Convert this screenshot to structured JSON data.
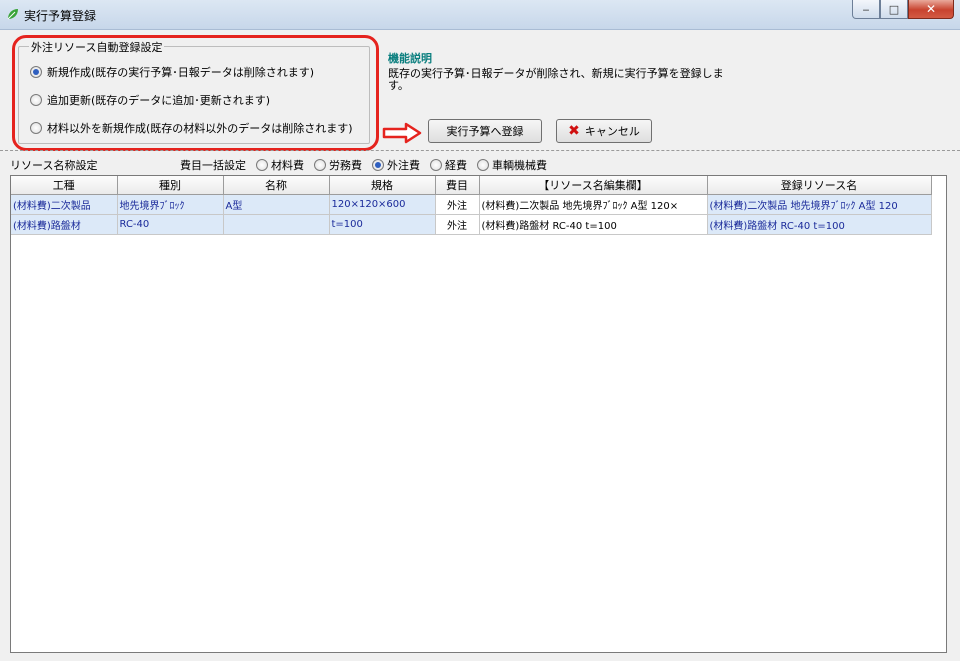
{
  "window": {
    "title": "実行予算登録",
    "min": "‒",
    "max": "□",
    "close": "✕"
  },
  "settings": {
    "group_title": "外注リソース自動登録設定",
    "options": [
      {
        "label": "新規作成(既存の実行予算･日報データは削除されます)",
        "selected": true
      },
      {
        "label": "追加更新(既存のデータに追加･更新されます)",
        "selected": false
      },
      {
        "label": "材料以外を新規作成(既存の材料以外のデータは削除されます)",
        "selected": false
      }
    ]
  },
  "description": {
    "title": "機能説明",
    "text": "既存の実行予算･日報データが削除され、新規に実行予算を登録しま す。"
  },
  "buttons": {
    "register": "実行予算へ登録",
    "cancel": "キャンセル"
  },
  "resource": {
    "label": "リソース名称設定",
    "bulk_label": "費目一括設定",
    "categories": [
      {
        "label": "材料費",
        "selected": false
      },
      {
        "label": "労務費",
        "selected": false
      },
      {
        "label": "外注費",
        "selected": true
      },
      {
        "label": "経費",
        "selected": false
      },
      {
        "label": "車輌機械費",
        "selected": false
      }
    ]
  },
  "table": {
    "columns": [
      "工種",
      "種別",
      "名称",
      "規格",
      "費目",
      "【リソース名編集欄】",
      "登録リソース名"
    ],
    "rows": [
      [
        "(材料費)二次製品",
        "地先境界ﾌﾞﾛｯｸ",
        "A型",
        "120×120×600",
        "外注",
        "(材料費)二次製品 地先境界ﾌﾞﾛｯｸ A型 120×",
        "(材料費)二次製品 地先境界ﾌﾞﾛｯｸ A型 120"
      ],
      [
        "(材料費)路盤材",
        "RC-40",
        "",
        "t=100",
        "外注",
        "(材料費)路盤材 RC-40 t=100",
        "(材料費)路盤材 RC-40 t=100"
      ]
    ]
  },
  "colors": {
    "highlight": "#e5231e",
    "accent_title": "#0b7f7f",
    "row_text": "#1a2a9a",
    "row_bg": "#dce9f8"
  },
  "icons": {
    "app": "leaf-icon",
    "arrow": "right-arrow-icon",
    "cancel": "x-icon"
  }
}
